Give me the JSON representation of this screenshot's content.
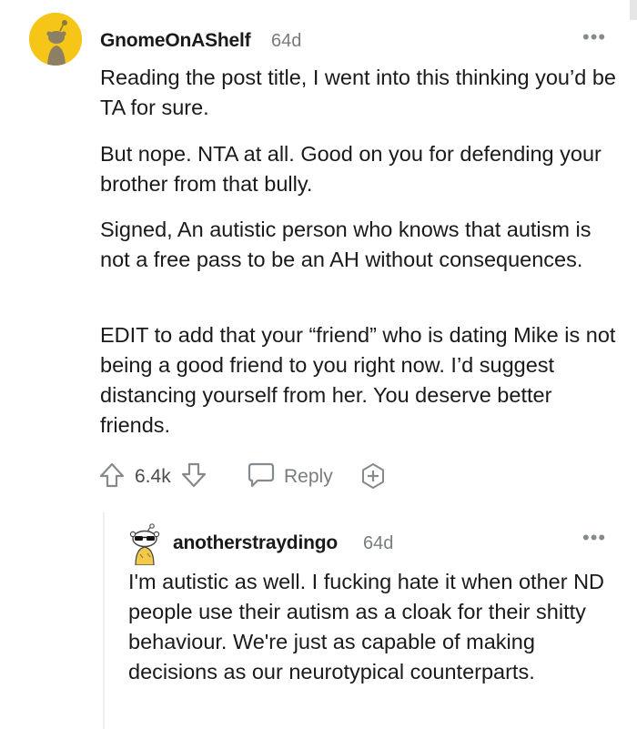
{
  "comment": {
    "username": "GnomeOnAShelf",
    "age": "64d",
    "more_label": "•••",
    "paragraphs": [
      "Reading the post title, I went into this thinking you’d be TA for sure.",
      "But nope. NTA at all. Good on you for defending your brother from that bully.",
      "Signed, An autistic person who knows that autism is not a free pass to be an AH without consequences.",
      "EDIT to add that your “friend” who is dating Mike is not being a good friend to you right now. I’d suggest distancing yourself from her. You deserve better friends."
    ],
    "vote_count": "6.4k",
    "reply_label": "Reply",
    "icons": {
      "avatar": "snoo-avatar-icon",
      "upvote": "upvote-arrow-icon",
      "downvote": "downvote-arrow-icon",
      "reply": "speech-bubble-icon",
      "award": "add-award-icon"
    }
  },
  "reply": {
    "username": "anotherstraydingo",
    "age": "64d",
    "more_label": "•••",
    "text": "I'm autistic as well. I fucking hate it when other ND people use their autism as a cloak for their shitty behaviour. We're just as capable of making decisions as our neurotypical counterparts.",
    "icons": {
      "avatar": "snoo-sunglasses-avatar-icon"
    }
  },
  "colors": {
    "avatar_bg": "#f5c518",
    "text": "#1a1a1b",
    "meta": "#787c7e",
    "icon": "#878a8c"
  }
}
